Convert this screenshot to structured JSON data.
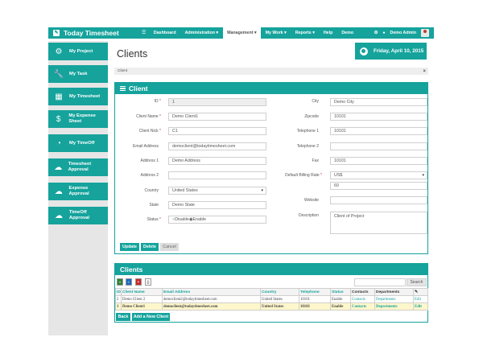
{
  "header": {
    "brand": "Today Timesheet",
    "nav": [
      {
        "label": "Dashboard",
        "active": false
      },
      {
        "label": "Administration ▾",
        "active": false
      },
      {
        "label": "Management ▾",
        "active": true
      },
      {
        "label": "My Work ▾",
        "active": false
      },
      {
        "label": "Reports ▾",
        "active": false
      },
      {
        "label": "Help",
        "active": false
      },
      {
        "label": "Demo",
        "active": false
      }
    ],
    "user": "Demo Admin"
  },
  "sidebar": {
    "items": [
      {
        "label": "My Project",
        "icon": "gears-icon"
      },
      {
        "label": "My Task",
        "icon": "wrench-icon"
      },
      {
        "label": "My Timesheet",
        "icon": "calendar-icon"
      },
      {
        "label": "My Expense Sheet",
        "icon": "money-icon"
      },
      {
        "label": "My TimeOff",
        "icon": "dashboard-icon"
      },
      {
        "label": "Timesheet Approval",
        "icon": "cloud-upload-icon"
      },
      {
        "label": "Expense Approval",
        "icon": "cloud-upload-icon"
      },
      {
        "label": "TimeOff Approval",
        "icon": "cloud-upload-icon"
      }
    ]
  },
  "page": {
    "title": "Clients",
    "date": "Friday, April 10, 2015",
    "breadcrumb": "Client"
  },
  "form": {
    "title": "Client",
    "left": [
      {
        "label": "ID",
        "required": true,
        "value": "1",
        "readonly": true
      },
      {
        "label": "Client Name",
        "required": true,
        "value": "Demo Client1"
      },
      {
        "label": "Client Nick",
        "required": true,
        "value": "C1"
      },
      {
        "label": "Email Address",
        "required": false,
        "value": "democlient@todaytimesheet.com"
      },
      {
        "label": "Address 1",
        "required": false,
        "value": "Demo Address"
      },
      {
        "label": "Address 2",
        "required": false,
        "value": ""
      },
      {
        "label": "Country",
        "required": false,
        "value": "United States",
        "select": true
      },
      {
        "label": "State",
        "required": false,
        "value": "Demo State"
      }
    ],
    "status": {
      "label": "Status",
      "required": true,
      "option_disable": "Disable",
      "option_enable": "Enable",
      "selected": "Enable"
    },
    "right": [
      {
        "label": "City",
        "required": false,
        "value": "Demo City"
      },
      {
        "label": "Zipcode",
        "required": false,
        "value": "10101"
      },
      {
        "label": "Telephone 1",
        "required": false,
        "value": "10101"
      },
      {
        "label": "Telephone 2",
        "required": false,
        "value": ""
      },
      {
        "label": "Fax",
        "required": false,
        "value": "10101"
      },
      {
        "label": "Default Billing Rate",
        "required": true,
        "value": "US$",
        "select": true
      },
      {
        "label": "",
        "required": false,
        "value": "60"
      },
      {
        "label": "Website",
        "required": false,
        "value": ""
      },
      {
        "label": "Description",
        "required": false,
        "value": "Client of Project",
        "textarea": true
      }
    ],
    "buttons": {
      "update": "Update",
      "delete": "Delete",
      "cancel": "Cancel"
    }
  },
  "grid": {
    "title": "Clients",
    "search_label": "Search",
    "export_icons": [
      "excel-icon",
      "csv-icon",
      "pdf-icon",
      "print-icon"
    ],
    "columns": [
      "ID",
      "Client Name",
      "Email Address",
      "Country",
      "Telephone",
      "Status",
      "Contacts",
      "Departments",
      "✎"
    ],
    "rows": [
      [
        "2",
        "Demo Client 2",
        "democlient2@todaytimesheet.com",
        "United States",
        "10101",
        "Enable",
        "Contacts",
        "Departments",
        "Edit"
      ],
      [
        "1",
        "Demo Client1",
        "democlient@todaytimesheet.com",
        "United States",
        "10101",
        "Enable",
        "Contacts",
        "Departments",
        "Edit"
      ]
    ],
    "back_label": "Back",
    "add_label": "Add a New Client"
  },
  "colors": {
    "accent": "#15a39c",
    "selected_row": "#fff7cc",
    "sidebar_bg": "#e6e6e6"
  }
}
